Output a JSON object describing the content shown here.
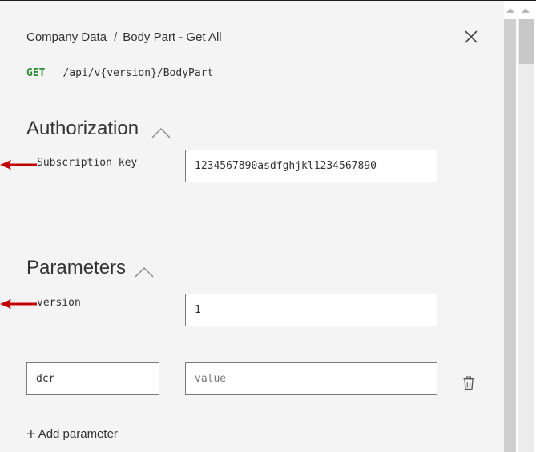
{
  "breadcrumb": {
    "parent": "Company Data",
    "separator": "/",
    "current": "Body Part - Get All"
  },
  "endpoint": {
    "method": "GET",
    "path": "/api/v{version}/BodyPart"
  },
  "authorization": {
    "title": "Authorization",
    "subscription_key_label": "Subscription key",
    "subscription_key_value": "1234567890asdfghjkl1234567890"
  },
  "parameters": {
    "title": "Parameters",
    "version_label": "version",
    "version_value": "1",
    "custom_name_value": "dcr",
    "custom_value_placeholder": "value",
    "add_label": "Add parameter"
  },
  "colors": {
    "method_green": "#2e8b35",
    "arrow_red": "#c00000",
    "panel_bg": "#f4f4f4"
  },
  "icons": {
    "close": "close-icon",
    "collapse": "chevron-up-icon",
    "delete": "trash-icon",
    "add": "plus-icon",
    "annotation": "red-arrow-icon"
  }
}
